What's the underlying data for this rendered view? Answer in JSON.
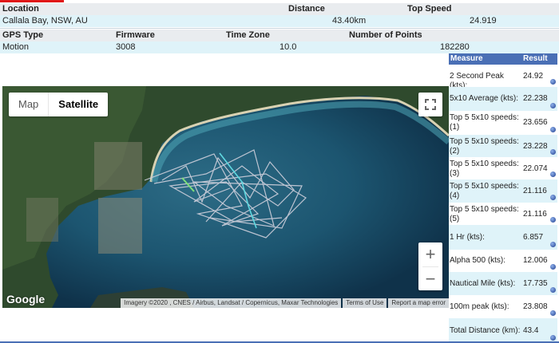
{
  "summary": {
    "headers_row1": {
      "location": "Location",
      "distance": "Distance",
      "top_speed": "Top Speed"
    },
    "values_row1": {
      "location": "Callala Bay, NSW, AU",
      "distance": "43.40km",
      "top_speed": "24.919"
    },
    "headers_row2": {
      "gps_type": "GPS Type",
      "firmware": "Firmware",
      "time_zone": "Time Zone",
      "points": "Number of Points"
    },
    "values_row2": {
      "gps_type": "Motion",
      "firmware": "3008",
      "time_zone": "10.0",
      "points": "182280"
    }
  },
  "map": {
    "map_label": "Map",
    "satellite_label": "Satellite",
    "zoom_in": "+",
    "zoom_out": "−",
    "logo": "Google",
    "attribution": "Imagery ©2020 , CNES / Airbus, Landsat / Copernicus, Maxar Technologies",
    "terms": "Terms of Use",
    "report": "Report a map error",
    "colors": {
      "sea": "#123a52",
      "track": "#c9c9d6",
      "highlight": "#5fd8e0"
    }
  },
  "stats": {
    "headers": {
      "measure": "Measure",
      "result": "Result"
    },
    "rows": [
      {
        "label": "2 Second Peak (kts):",
        "value": "24.92"
      },
      {
        "label": "5x10 Average (kts):",
        "value": "22.238"
      },
      {
        "label": "Top 5 5x10 speeds: (1)",
        "value": "23.656"
      },
      {
        "label": "Top 5 5x10 speeds: (2)",
        "value": "23.228"
      },
      {
        "label": "Top 5 5x10 speeds: (3)",
        "value": "22.074"
      },
      {
        "label": "Top 5 5x10 speeds: (4)",
        "value": "21.116"
      },
      {
        "label": "Top 5 5x10 speeds: (5)",
        "value": "21.116"
      },
      {
        "label": "1 Hr (kts):",
        "value": "6.857"
      },
      {
        "label": "Alpha 500 (kts):",
        "value": "12.006"
      },
      {
        "label": "Nautical Mile (kts):",
        "value": "17.735"
      },
      {
        "label": "100m peak (kts):",
        "value": "23.808"
      },
      {
        "label": "Total Distance (km):",
        "value": "43.4"
      }
    ]
  }
}
